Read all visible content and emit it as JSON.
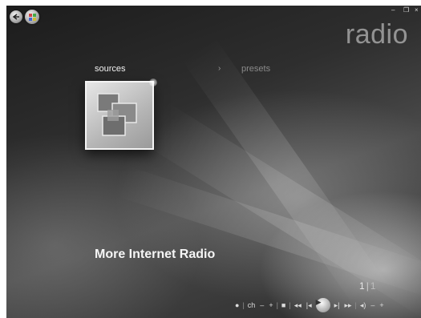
{
  "window": {
    "title": "radio",
    "controls": {
      "minimize": "–",
      "restore": "❐",
      "close": "×"
    }
  },
  "nav": {
    "back_icon": "back-arrow-icon",
    "start_icon": "windows-logo-icon"
  },
  "tabs": {
    "sources": "sources",
    "separator": "›",
    "presets": "presets"
  },
  "tile": {
    "icon": "internet-radio-tile-icon"
  },
  "caption": "More Internet Radio",
  "pager": {
    "current": "1",
    "total": "1"
  },
  "transport": {
    "record": "●",
    "ch": "ch",
    "ch_minus": "–",
    "ch_plus": "+",
    "stop": "■",
    "rewind": "◂◂",
    "prev": "|◂",
    "play": "▶",
    "next": "▸|",
    "forward": "▸▸",
    "mute": "◂)",
    "vol_minus": "–",
    "vol_plus": "+"
  }
}
